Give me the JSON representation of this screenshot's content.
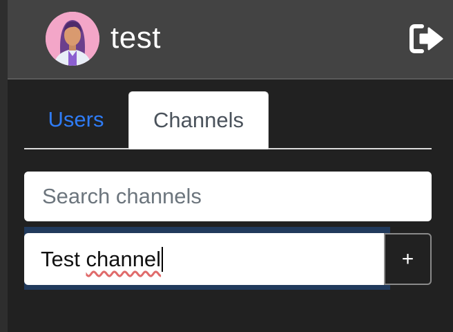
{
  "header": {
    "username": "test",
    "avatar_icon": "female-user-avatar-icon",
    "logout_icon": "sign-out-icon"
  },
  "tabs": [
    {
      "label": "Users",
      "active": false
    },
    {
      "label": "Channels",
      "active": true
    }
  ],
  "search": {
    "placeholder": "Search channels",
    "value": ""
  },
  "new_channel": {
    "value_word1": "Test ",
    "value_word2": "channel",
    "add_label": "+"
  },
  "colors": {
    "accent": "#2f7cf6",
    "header_bg": "#434343",
    "page_bg": "#212121",
    "focus_ring": "#213a5c"
  }
}
